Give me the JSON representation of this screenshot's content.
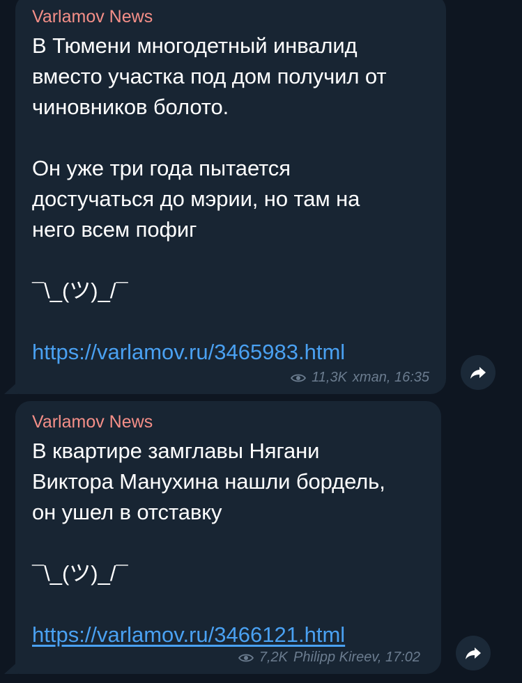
{
  "messages": [
    {
      "sender": "Varlamov News",
      "paragraphs": [
        "В Тюмени многодетный инвалид\nвместо участка под дом получил от\nчиновников болото.",
        "Он уже три года пытается\nдостучаться до мэрии, но там на\nнего всем пофиг"
      ],
      "shrug": "¯\\_(ツ)_/¯",
      "link": "https://varlamov.ru/3465983.html",
      "views": "11,3K",
      "author_time": "xman, 16:35",
      "share_icon": "share-arrow-icon"
    },
    {
      "sender": "Varlamov News",
      "paragraphs": [
        "В квартире замглавы Нягани\nВиктора Манухина нашли бордель,\nон ушел в отставку"
      ],
      "shrug": "¯\\_(ツ)_/¯",
      "link": "https://varlamov.ru/3466121.html",
      "views": "7,2K",
      "author_time": "Philipp Kireev, 17:02",
      "share_icon": "share-arrow-icon"
    }
  ],
  "colors": {
    "background": "#0e1621",
    "bubble": "#182533",
    "sender": "#f58f88",
    "link": "#4aa1f2",
    "meta": "#6b7c8f"
  }
}
